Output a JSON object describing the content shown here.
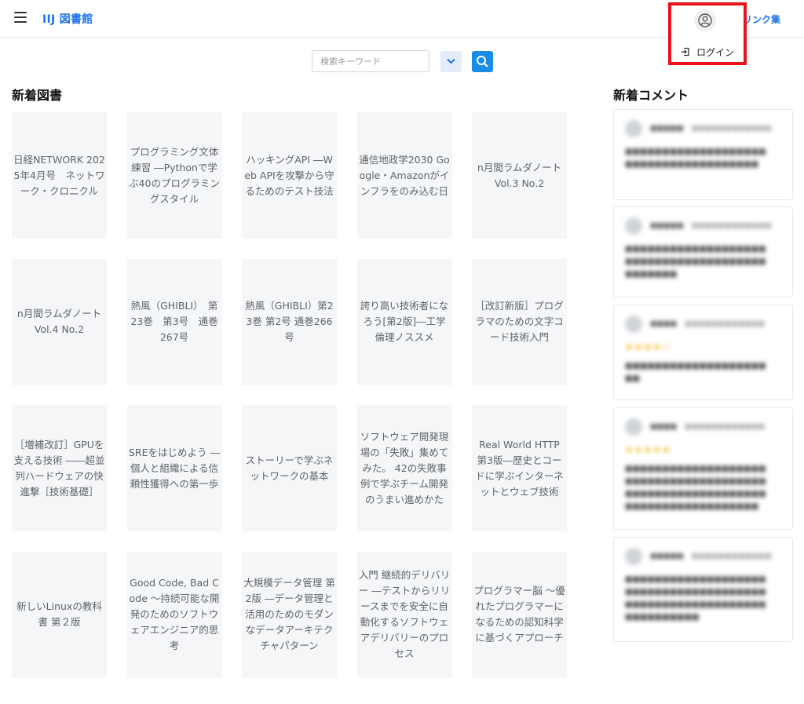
{
  "header": {
    "logo": "IIJ 図書館",
    "link": "リンク集"
  },
  "account_menu": {
    "avatar_icon": "user-circle-icon",
    "login_label": "ログイン",
    "login_icon": "sign-in-icon",
    "highlight_color": "#e8141b"
  },
  "search": {
    "placeholder": "検索キーワード",
    "value": ""
  },
  "sections": {
    "new_books": "新着図書",
    "new_comments": "新着コメント"
  },
  "books": [
    "日経NETWORK 2025年4月号　ネットワーク・クロニクル",
    "プログラミング文体練習 ―Pythonで学ぶ40のプログラミングスタイル",
    "ハッキングAPI ―Web APIを攻撃から守るためのテスト技法",
    "通信地政学2030 Google・Amazonがインフラをのみ込む日",
    "n月間ラムダノート Vol.3 No.2",
    "n月間ラムダノート Vol.4 No.2",
    "熱風（GHIBLI）　第23巻　第3号　通巻267号",
    "熱風（GHIBLI）第23巻 第2号 通巻266号",
    "誇り高い技術者になろう[第2版]―工学倫理ノススメ",
    "［改訂新版］プログラマのための文字コード技術入門",
    "［増補改訂］GPUを支える技術 ――超並列ハードウェアの快進撃［技術基礎］",
    "SREをはじめよう ―個人と組織による信頼性獲得への第一歩",
    "ストーリーで学ぶネットワークの基本",
    "ソフトウェア開発現場の「失敗」集めてみた。 42の失敗事例で学ぶチーム開発のうまい進めかた",
    "Real World HTTP 第3版―歴史とコードに学ぶインターネットとウェブ技術",
    "新しいLinuxの教科書 第２版",
    "Good Code, Bad Code ～持続可能な開発のためのソフトウェアエンジニア的思考",
    "大規模データ管理 第2版 ―データ管理と活用のためのモダンなデータアーキテクチャパターン",
    "入門 継続的デリバリー ―テストからリリースまでを安全に自動化するソフトウェアデリバリーのプロセス",
    "プログラマー脳 ～優れたプログラマーになるための認知科学に基づくアプローチ"
  ],
  "colors": {
    "accent": "#1a73e8",
    "search_button": "#1a8ce6",
    "stars": "#f5b400"
  }
}
